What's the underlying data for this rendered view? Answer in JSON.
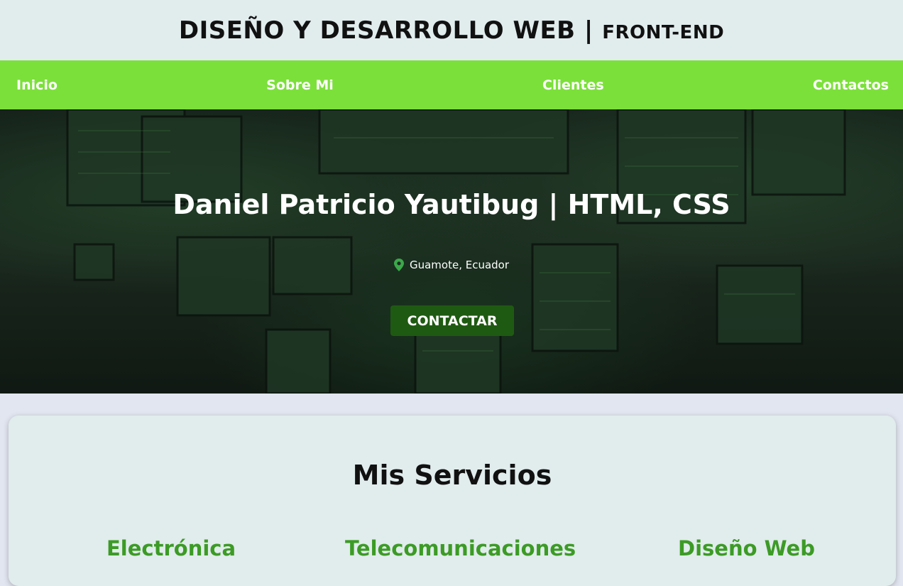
{
  "header": {
    "title": "DISEÑO Y DESARROLLO WEB |",
    "subtitle": "FRONT-END"
  },
  "nav": {
    "items": [
      {
        "label": "Inicio"
      },
      {
        "label": "Sobre Mi"
      },
      {
        "label": "Clientes"
      },
      {
        "label": "Contactos"
      }
    ]
  },
  "hero": {
    "name": "Daniel Patricio Yautibug | HTML, CSS",
    "location": "Guamote, Ecuador",
    "location_icon": "map-pin-icon",
    "cta_label": "CONTACTAR"
  },
  "services": {
    "title": "Mis Servicios",
    "items": [
      {
        "label": "Electrónica"
      },
      {
        "label": "Telecomunicaciones"
      },
      {
        "label": "Diseño Web"
      }
    ]
  },
  "colors": {
    "header_bg": "#e1eced",
    "nav_bg": "#7ce03a",
    "button_bg": "#1f5a12",
    "service_heading": "#3c9b25"
  }
}
